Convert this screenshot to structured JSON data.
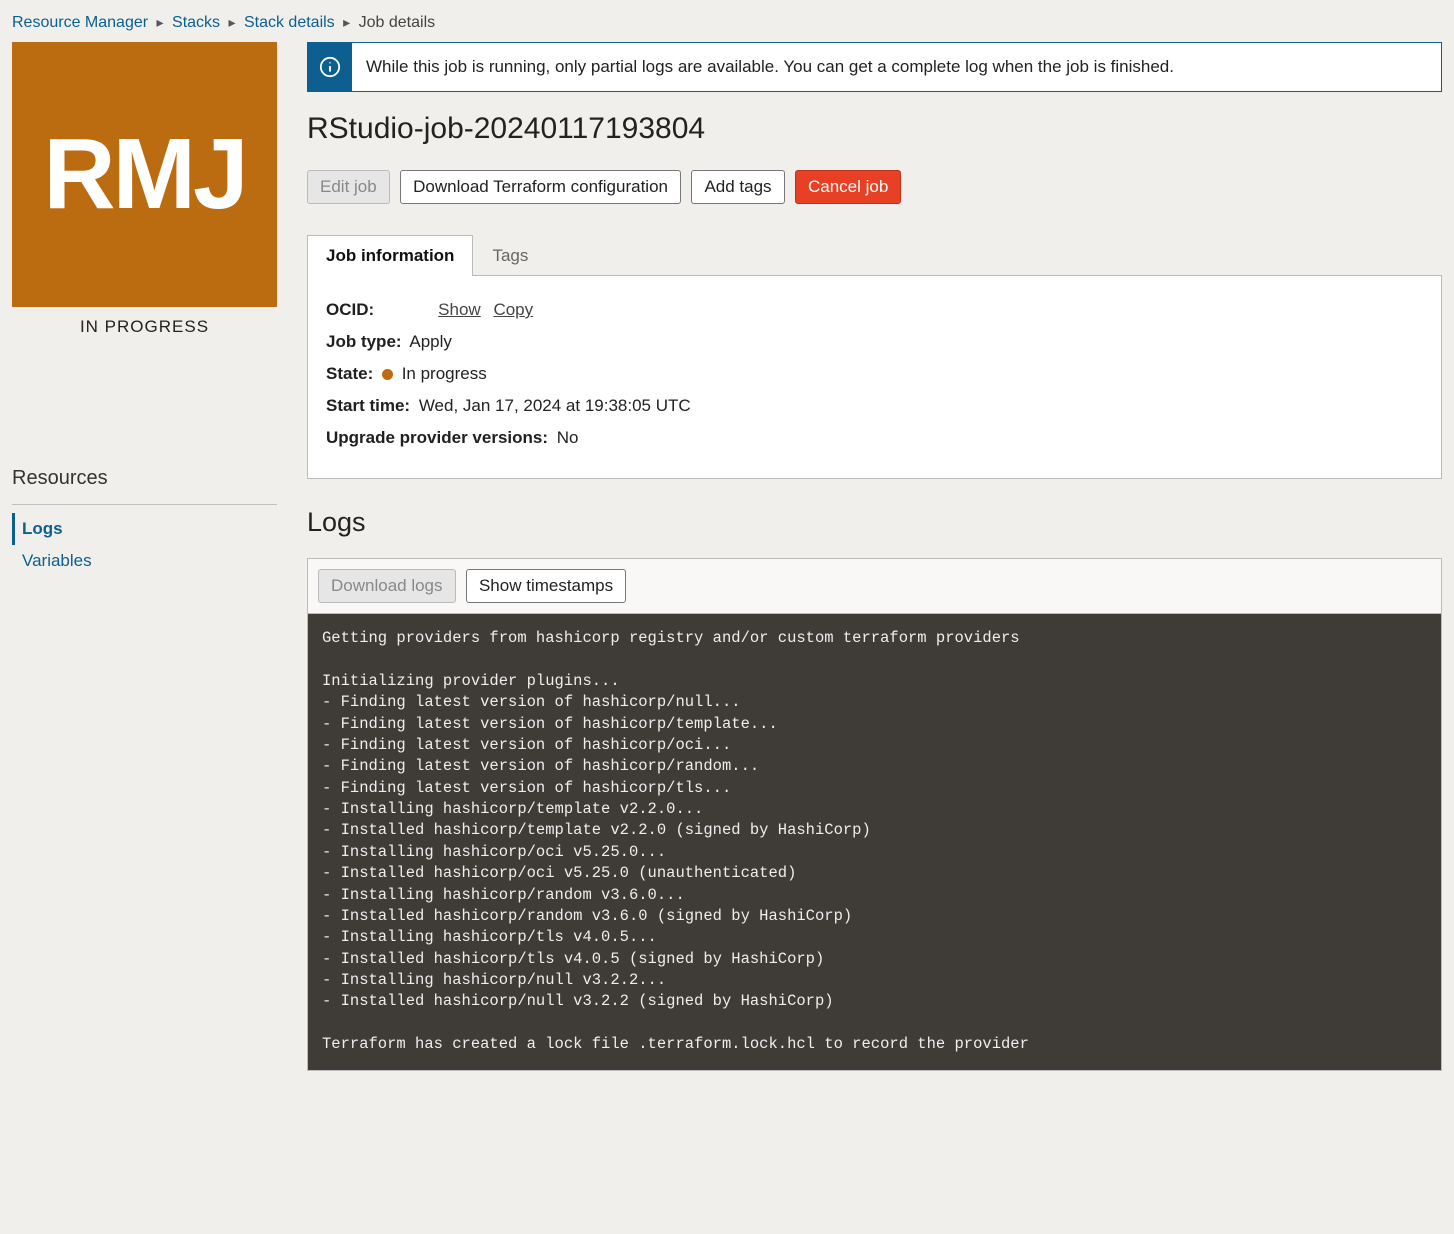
{
  "breadcrumb": {
    "items": [
      {
        "label": "Resource Manager"
      },
      {
        "label": "Stacks"
      },
      {
        "label": "Stack details"
      },
      {
        "label": "Job details"
      }
    ]
  },
  "sidebar": {
    "tile_initials": "RMJ",
    "tile_status": "IN PROGRESS",
    "resources_heading": "Resources",
    "items": [
      {
        "label": "Logs",
        "active": true
      },
      {
        "label": "Variables",
        "active": false
      }
    ]
  },
  "alert": {
    "message": "While this job is running, only partial logs are available. You can get a complete log when the job is finished."
  },
  "title": "RStudio-job-20240117193804",
  "toolbar": {
    "edit_label": "Edit job",
    "download_config_label": "Download Terraform configuration",
    "add_tags_label": "Add tags",
    "cancel_label": "Cancel job"
  },
  "tabs": {
    "info_label": "Job information",
    "tags_label": "Tags"
  },
  "info": {
    "ocid_label": "OCID:",
    "ocid_show": "Show",
    "ocid_copy": "Copy",
    "jobtype_label": "Job type:",
    "jobtype_value": "Apply",
    "state_label": "State:",
    "state_value": "In progress",
    "start_label": "Start time:",
    "start_value": "Wed, Jan 17, 2024 at 19:38:05 UTC",
    "upgrade_label": "Upgrade provider versions:",
    "upgrade_value": "No"
  },
  "logs": {
    "heading": "Logs",
    "download_label": "Download logs",
    "timestamps_label": "Show timestamps",
    "content": "Getting providers from hashicorp registry and/or custom terraform providers\n\nInitializing provider plugins...\n- Finding latest version of hashicorp/null...\n- Finding latest version of hashicorp/template...\n- Finding latest version of hashicorp/oci...\n- Finding latest version of hashicorp/random...\n- Finding latest version of hashicorp/tls...\n- Installing hashicorp/template v2.2.0...\n- Installed hashicorp/template v2.2.0 (signed by HashiCorp)\n- Installing hashicorp/oci v5.25.0...\n- Installed hashicorp/oci v5.25.0 (unauthenticated)\n- Installing hashicorp/random v3.6.0...\n- Installed hashicorp/random v3.6.0 (signed by HashiCorp)\n- Installing hashicorp/tls v4.0.5...\n- Installed hashicorp/tls v4.0.5 (signed by HashiCorp)\n- Installing hashicorp/null v3.2.2...\n- Installed hashicorp/null v3.2.2 (signed by HashiCorp)\n\nTerraform has created a lock file .terraform.lock.hcl to record the provider"
  },
  "colors": {
    "accent": "#0c5f8e",
    "tile": "#bb6b10",
    "danger": "#e74025"
  }
}
